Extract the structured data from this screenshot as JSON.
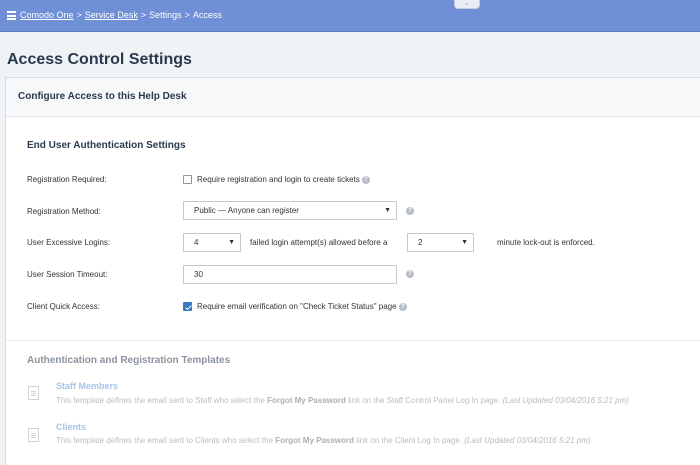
{
  "breadcrumb": {
    "items": [
      "Comodo One",
      "Service Desk",
      "Settings",
      "Access"
    ],
    "separator": ">"
  },
  "page_title": "Access Control Settings",
  "card_title": "Configure Access to this Help Desk",
  "section_title": "End User Authentication Settings",
  "fields": {
    "registration_required": {
      "label": "Registration Required:",
      "checkbox_label": "Require registration and login to create tickets",
      "checked": false
    },
    "registration_method": {
      "label": "Registration Method:",
      "value": "Public — Anyone can register"
    },
    "excessive_logins": {
      "label": "User Excessive Logins:",
      "attempts_value": "4",
      "middle_text": "failed login attempt(s) allowed before a",
      "lockout_value": "2",
      "end_text": "minute lock-out is enforced."
    },
    "session_timeout": {
      "label": "User Session Timeout:",
      "value": "30"
    },
    "client_quick_access": {
      "label": "Client Quick Access:",
      "checkbox_label": "Require email verification on \"Check Ticket Status\" page",
      "checked": true
    }
  },
  "help_glyph": "?",
  "dropdown_glyph": "▼",
  "templates": {
    "title": "Authentication and Registration Templates",
    "items": [
      {
        "name": "Staff Members",
        "desc_pre": "This template defines the email sent to Staff who select the ",
        "desc_bold": "Forgot My Password",
        "desc_post": " link on the Staff Control Panel Log In page. ",
        "updated": "(Last Updated 03/04/2016 5:21 pm)"
      },
      {
        "name": "Clients",
        "desc_pre": "This template defines the email sent to Clients who select the ",
        "desc_bold": "Forgot My Password",
        "desc_post": " link on the Client Log In page. ",
        "updated": "(Last Updated 03/04/2016 5:21 pm)"
      }
    ]
  },
  "colors": {
    "topbar": "#6f8fd6",
    "checkbox_checked": "#3578c5",
    "page_bg": "#f0f3f6"
  }
}
